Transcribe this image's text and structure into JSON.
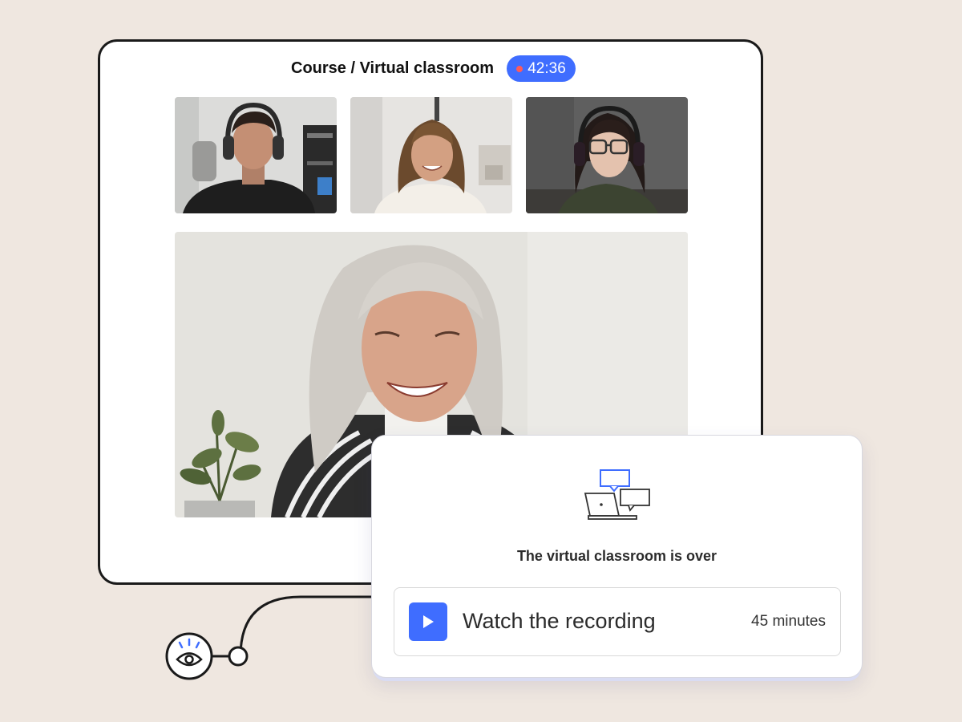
{
  "window": {
    "title": "Course / Virtual classroom",
    "timer": "42:36"
  },
  "participants": [
    {
      "name": "participant-man-headphones"
    },
    {
      "name": "participant-woman-smiling"
    },
    {
      "name": "participant-woman-glasses"
    }
  ],
  "main_speaker": {
    "name": "main-speaker-woman"
  },
  "card": {
    "message": "The virtual classroom is over",
    "recording_label": "Watch the recording",
    "duration": "45 minutes"
  },
  "icons": {
    "chat": "laptop-chat-icon",
    "play": "play-icon",
    "eye": "eye-icon"
  },
  "colors": {
    "accent": "#3f6dff",
    "background": "#efe7e0",
    "record_dot": "#ff5a5a"
  }
}
